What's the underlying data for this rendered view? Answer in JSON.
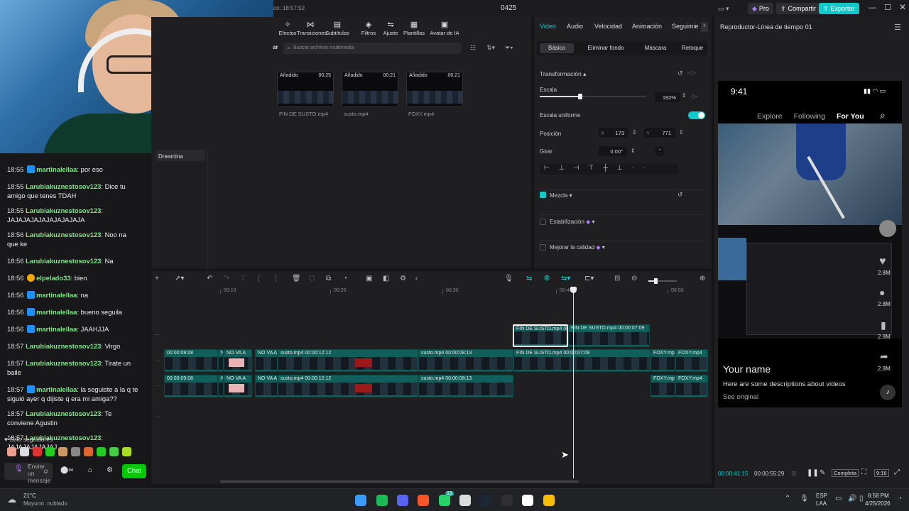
{
  "titlebar": {
    "saved": "co: 18:57:52",
    "project": "0425",
    "pro": "Pro",
    "share": "Compartir",
    "export": "Exportar"
  },
  "tools": [
    {
      "label": "Efectos",
      "icon": "effects-icon"
    },
    {
      "label": "Transiciones",
      "icon": "transitions-icon"
    },
    {
      "label": "Subtítulos",
      "icon": "subtitles-icon"
    },
    {
      "label": "Filtros",
      "icon": "filters-icon"
    },
    {
      "label": "Ajuste",
      "icon": "adjust-icon"
    },
    {
      "label": "Plantillas",
      "icon": "templates-icon"
    },
    {
      "label": "Avatar de IA",
      "icon": "ai-avatar-icon"
    }
  ],
  "media": {
    "search_placeholder": "Buscar archivos multimedia",
    "left_label": "Dreamina",
    "partial": "ar",
    "items": [
      {
        "tag": "Añadido",
        "dur": "00:25",
        "name": "FIN DE SUSTO.mp4"
      },
      {
        "tag": "Añadido",
        "dur": "00:21",
        "name": "susto.mp4"
      },
      {
        "tag": "Añadido",
        "dur": "00:21",
        "name": "FOXY.mp4"
      }
    ]
  },
  "props": {
    "tabs": [
      "Video",
      "Audio",
      "Velocidad",
      "Animación",
      "Seguimie"
    ],
    "subtabs": [
      "Básico",
      "Eliminar fondo",
      "Máscara",
      "Retoque"
    ],
    "transform": "Transformación",
    "scale_label": "Escala",
    "scale_value": "192%",
    "scale_fraction": 0.38,
    "uniform": "Escala uniforme",
    "position": "Posición",
    "x_label": "X",
    "x": "173",
    "y_label": "Y",
    "y": "771",
    "rotate": "Girar",
    "rotate_value": "0.00°",
    "rotate_btn": "-",
    "blend": "Mezcla",
    "stabilize": "Estabilización",
    "enhance": "Mejorar la calidad"
  },
  "preview": {
    "title": "Reproductor-Línea de tiempo 01",
    "time": "9:41",
    "nav": [
      "Explore",
      "Following",
      "For You"
    ],
    "likes": "2.8M",
    "comments": "2.8M",
    "saves": "2.8M",
    "shares": "2.8M",
    "name": "Your name",
    "desc": "Here are some descriptions about videos",
    "see": "See original",
    "current": "00:00:41:15",
    "total": "00:00:55:29",
    "full": "Completa",
    "ratio": "9:16"
  },
  "ruler": [
    "00:10",
    "00:20",
    "00:30",
    "00:40",
    "00:50"
  ],
  "tracks": {
    "top": [
      {
        "label": "FIN DE SUSTO.mp4  00",
        "sel": true
      },
      {
        "label": "FIN DE SUSTO.mp4   00:00:07:09",
        "sel": false
      }
    ],
    "mid": [
      {
        "label": "00:00:09:08"
      },
      {
        "label": "N"
      },
      {
        "label": "NO VA A"
      },
      {
        "label": "NO VA A"
      },
      {
        "label": "susto.mp4  00:00:12:12"
      },
      {
        "label": "susto.mp4   00:00:08:13"
      },
      {
        "label": "FIN DE SUSTO.mp4   00:00:07:09"
      },
      {
        "label": "FOXY.mp4"
      },
      {
        "label": "FOXY.mp4"
      }
    ],
    "low": [
      {
        "label": "00:00:09:08"
      },
      {
        "label": "N"
      },
      {
        "label": "NO VA A"
      },
      {
        "label": "NO VA A"
      },
      {
        "label": "susto.mp4  00:00:12:12"
      },
      {
        "label": "susto.mp4   00:00:08:13"
      },
      {
        "label": "FOXY.mp4"
      },
      {
        "label": "FOXY.mp4"
      }
    ]
  },
  "chat": {
    "messages": [
      {
        "time": "18:55",
        "user": "martinalellaa",
        "text": ": por eso",
        "badge": "prime"
      },
      {
        "time": "18:55",
        "user": "Larubiakuznestosov123",
        "text": ": Dice tu amigo que tenes TDAH",
        "badge": ""
      },
      {
        "time": "18:55",
        "user": "Larubiakuznestosov123",
        "text": ": JAJAJAJAJAJAJAJAJAJA",
        "badge": ""
      },
      {
        "time": "18:56",
        "user": "Larubiakuznestosov123",
        "text": ": Noo na que ke",
        "badge": ""
      },
      {
        "time": "18:56",
        "user": "Larubiakuznestosov123",
        "text": ": Na",
        "badge": ""
      },
      {
        "time": "18:56",
        "user": "elpelado33",
        "text": ": bien",
        "badge": "sub"
      },
      {
        "time": "18:56",
        "user": "martinalellaa",
        "text": ": na",
        "badge": "prime"
      },
      {
        "time": "18:56",
        "user": "martinalellaa",
        "text": ": bueno seguila",
        "badge": "prime"
      },
      {
        "time": "18:56",
        "user": "martinalellaa",
        "text": ": JAAHJJA",
        "badge": "prime"
      },
      {
        "time": "18:57",
        "user": "Larubiakuznestosov123",
        "text": ": Virgo",
        "badge": ""
      },
      {
        "time": "18:57",
        "user": "Larubiakuznestosov123",
        "text": ": Tirate un baile",
        "badge": ""
      },
      {
        "time": "18:57",
        "user": "martinalellaa",
        "text": ": la seguiste a la q te siguió ayer q dijiste q era mi amiga??",
        "badge": "prime"
      },
      {
        "time": "18:57",
        "user": "Larubiakuznestosov123",
        "text": ": Te conviene Agustin",
        "badge": ""
      },
      {
        "time": "18:57",
        "user": "Larubiakuznestosov123",
        "text": ": JAJAJAJAJAJAJ",
        "badge": ""
      }
    ],
    "followers_only": "Solo seguidores",
    "send_placeholder": "Enviar un mensaje",
    "chat_button": "Chat"
  },
  "taskbar": {
    "temp": "21°C",
    "weather": "Mayorm. nublado",
    "lang1": "ESP",
    "lang2": "LAA",
    "time": "6:58 PM",
    "date": "4/25/2026",
    "badge": "13"
  },
  "colors": {
    "accent": "#00c8c8",
    "chat_bg": "#18181b",
    "clip": "#0f5f5a"
  }
}
